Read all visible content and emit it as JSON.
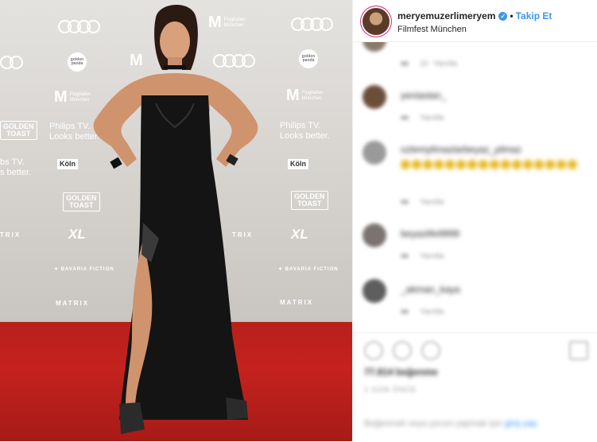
{
  "post": {
    "username": "meryemuzerlimeryem",
    "separator": "•",
    "follow_label": "Takip Et",
    "location": "Filmfest München",
    "verified_icon": "verified-badge-icon"
  },
  "photo": {
    "backdrop_brands": [
      "Flughafen München",
      "Philips TV.",
      "Looks better.",
      "GOLDEN TOAST",
      "Köln",
      "BAVARIA FICTION",
      "MATRIX",
      "XL"
    ],
    "colors": {
      "carpet": "#c4221e",
      "wall": "#dedcda",
      "dress": "#141414"
    }
  },
  "comments": [
    {
      "user": "",
      "text": "",
      "meta": [
        "1h",
        "Yanıtla"
      ]
    },
    {
      "user": "yeniaslan_",
      "text": "",
      "meta": [
        "1h",
        "Yanıtla"
      ]
    },
    {
      "user": "ozlemyilmazlarbeyaz_yilmaz",
      "text": "",
      "meta": [
        "1h",
        "Yanıtla"
      ]
    },
    {
      "user": "beyazlife9999",
      "text": "",
      "meta": [
        "1h",
        "Yanıtla"
      ]
    },
    {
      "user": "_akman_kaya",
      "text": "",
      "meta": [
        "1h",
        "Yanıtla"
      ]
    }
  ],
  "actions": {
    "likes": "77.814 beğenme",
    "time": "1 GÜN ÖNCE",
    "login_prompt": "Beğenmek veya yorum yapmak için",
    "login_link": "giriş yap"
  }
}
